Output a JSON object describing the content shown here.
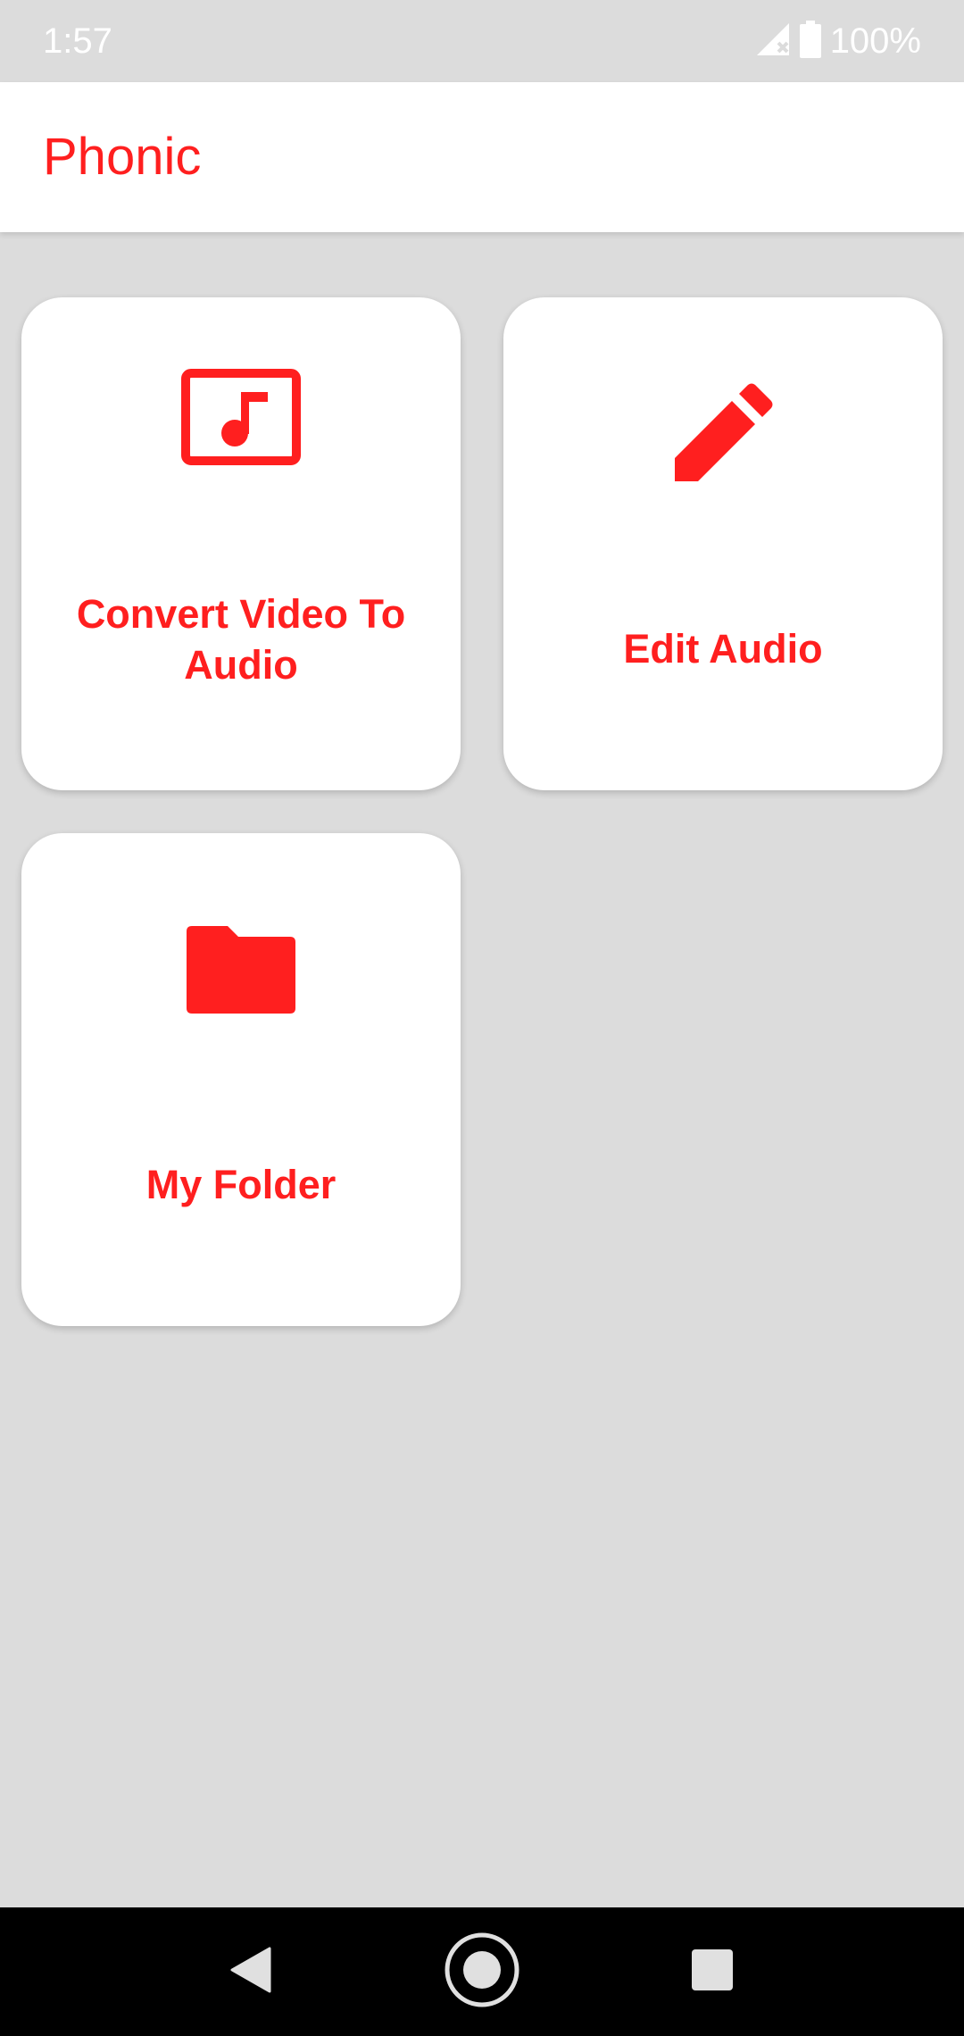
{
  "status_bar": {
    "time": "1:57",
    "battery_percent": "100%",
    "icons": [
      "signal-no-sim-icon",
      "battery-icon"
    ]
  },
  "app_bar": {
    "title": "Phonic"
  },
  "cards": [
    {
      "label": "Convert Video To Audio",
      "icon": "video-music-icon"
    },
    {
      "label": "Edit Audio",
      "icon": "pencil-icon"
    },
    {
      "label": "My Folder",
      "icon": "folder-icon"
    }
  ],
  "nav_bar": {
    "icons": [
      "back-icon",
      "home-icon",
      "recents-icon"
    ]
  },
  "colors": {
    "accent": "#ff1f1f",
    "background": "#dcdcdc",
    "card": "#ffffff",
    "nav_bar": "#000000"
  }
}
